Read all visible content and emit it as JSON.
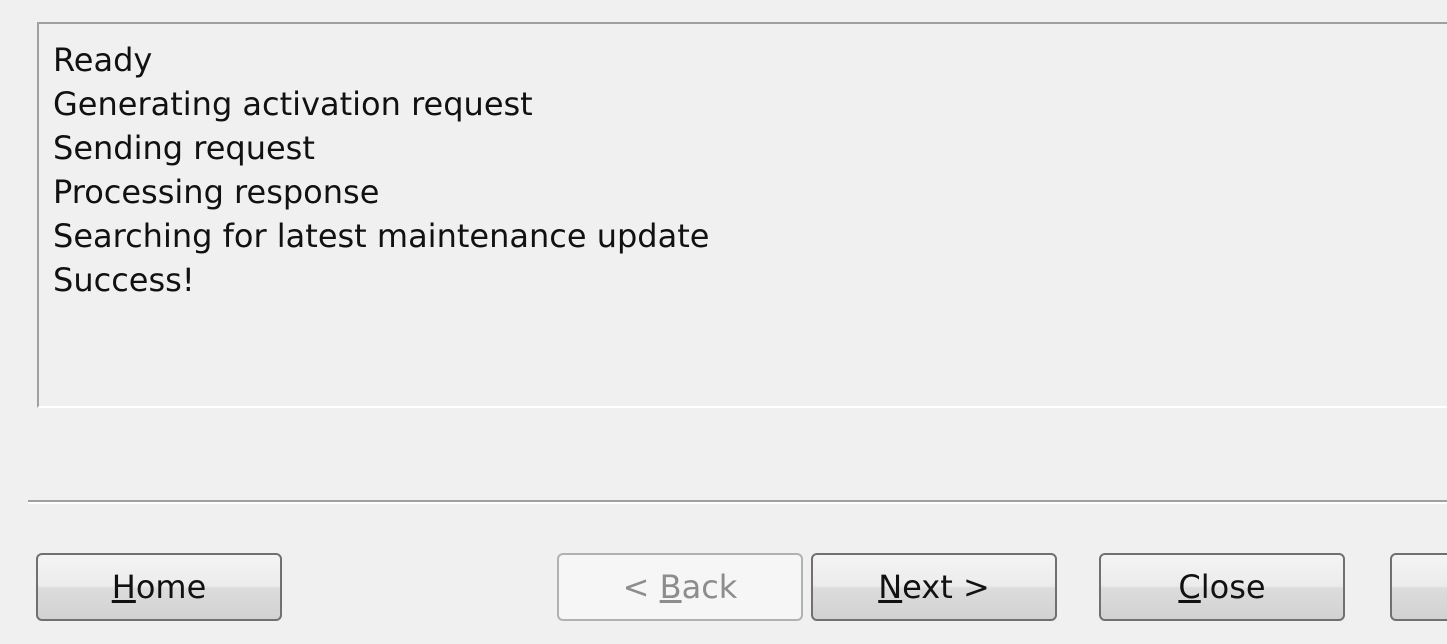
{
  "log": {
    "lines": [
      "Ready",
      "Generating activation request",
      "Sending request",
      "Processing response",
      "Searching for latest maintenance update",
      "Success!"
    ]
  },
  "buttons": {
    "home": {
      "accel": "H",
      "rest": "ome"
    },
    "back": {
      "pre": "< ",
      "accel": "B",
      "rest": "ack"
    },
    "next": {
      "accel": "N",
      "rest": "ext >"
    },
    "close": {
      "accel": "C",
      "rest": "lose"
    }
  }
}
